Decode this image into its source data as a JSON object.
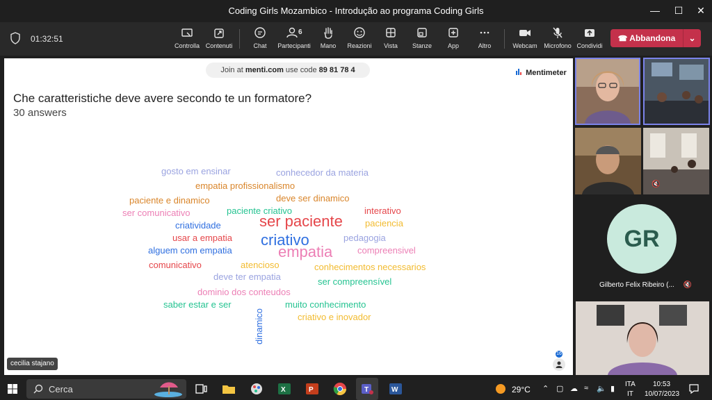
{
  "window": {
    "title": "Coding Girls Mozambico - Introdução ao programa Coding Girls",
    "controls": [
      "minimize-icon",
      "maximize-icon",
      "close-icon"
    ]
  },
  "toolbar": {
    "timer": "01:32:51",
    "buttons": [
      {
        "label": "Controlla",
        "icon": "control-icon"
      },
      {
        "label": "Contenuti",
        "icon": "share-content-icon"
      },
      {
        "label": "Chat",
        "icon": "chat-icon"
      },
      {
        "label": "Partecipanti",
        "icon": "people-icon",
        "badge": "6"
      },
      {
        "label": "Mano",
        "icon": "raise-hand-icon"
      },
      {
        "label": "Reazioni",
        "icon": "smiley-icon"
      },
      {
        "label": "Vista",
        "icon": "grid-view-icon"
      },
      {
        "label": "Stanze",
        "icon": "breakout-rooms-icon"
      },
      {
        "label": "App",
        "icon": "add-app-icon"
      },
      {
        "label": "Altro",
        "icon": "more-icon"
      },
      {
        "label": "Webcam",
        "icon": "camera-icon"
      },
      {
        "label": "Microfono",
        "icon": "mic-off-icon"
      },
      {
        "label": "Condividi",
        "icon": "share-icon"
      }
    ],
    "leave_label": "Abbandona",
    "leave_color": "#c4314b"
  },
  "presentation": {
    "join_prefix": "Join at",
    "join_site": "menti.com",
    "join_mid": "use code",
    "join_code": "89 81 78 4",
    "brand": "Mentimeter",
    "question": "Che caratteristiche deve avere secondo te un formatore?",
    "answers": "30 answers",
    "participants_count": "16",
    "presenter_tag": "cecilia stajano",
    "words": [
      {
        "text": "gosto em ensinar",
        "color": "#9aa3e0"
      },
      {
        "text": "conhecedor da materia",
        "color": "#9aa3e0"
      },
      {
        "text": "empatia profissionalismo",
        "color": "#d9852a"
      },
      {
        "text": "paciente e dinamico",
        "color": "#d9852a"
      },
      {
        "text": "deve ser dinamico",
        "color": "#d9852a"
      },
      {
        "text": "ser comunicativo",
        "color": "#ec7fb5"
      },
      {
        "text": "paciente criativo",
        "color": "#25c391"
      },
      {
        "text": "interativo",
        "color": "#e5464a"
      },
      {
        "text": "criatividade",
        "color": "#2f6fe0"
      },
      {
        "text": "ser paciente",
        "color": "#e5464a"
      },
      {
        "text": "paciencia",
        "color": "#f2bb2f"
      },
      {
        "text": "usar a empatia",
        "color": "#e5464a"
      },
      {
        "text": "criativo",
        "color": "#2f6fe0"
      },
      {
        "text": "pedagogia",
        "color": "#9aa3e0"
      },
      {
        "text": "alguem com empatia",
        "color": "#2f6fe0"
      },
      {
        "text": "empatia",
        "color": "#ec7fb5"
      },
      {
        "text": "compreensivel",
        "color": "#ec7fb5"
      },
      {
        "text": "comunicativo",
        "color": "#e5464a"
      },
      {
        "text": "atencioso",
        "color": "#f2bb2f"
      },
      {
        "text": "conhecimentos necessarios",
        "color": "#f2bb2f"
      },
      {
        "text": "deve ter empatia",
        "color": "#9aa3e0"
      },
      {
        "text": "ser compreensível",
        "color": "#25c391"
      },
      {
        "text": "dominio dos conteudos",
        "color": "#ec7fb5"
      },
      {
        "text": "saber estar e ser",
        "color": "#25c391"
      },
      {
        "text": "muito conhecimento",
        "color": "#25c391"
      },
      {
        "text": "criativo e inovador",
        "color": "#f2bb2f"
      },
      {
        "text": "dinamico",
        "color": "#2f6fe0"
      }
    ]
  },
  "participants": {
    "gr_initials": "GR",
    "gr_name": "Gilberto Felix Ribeiro (..."
  },
  "taskbar": {
    "search_placeholder": "Cerca",
    "weather": "29°C",
    "lang1": "ITA",
    "lang2": "IT",
    "time": "10:53",
    "date": "10/07/2023"
  }
}
